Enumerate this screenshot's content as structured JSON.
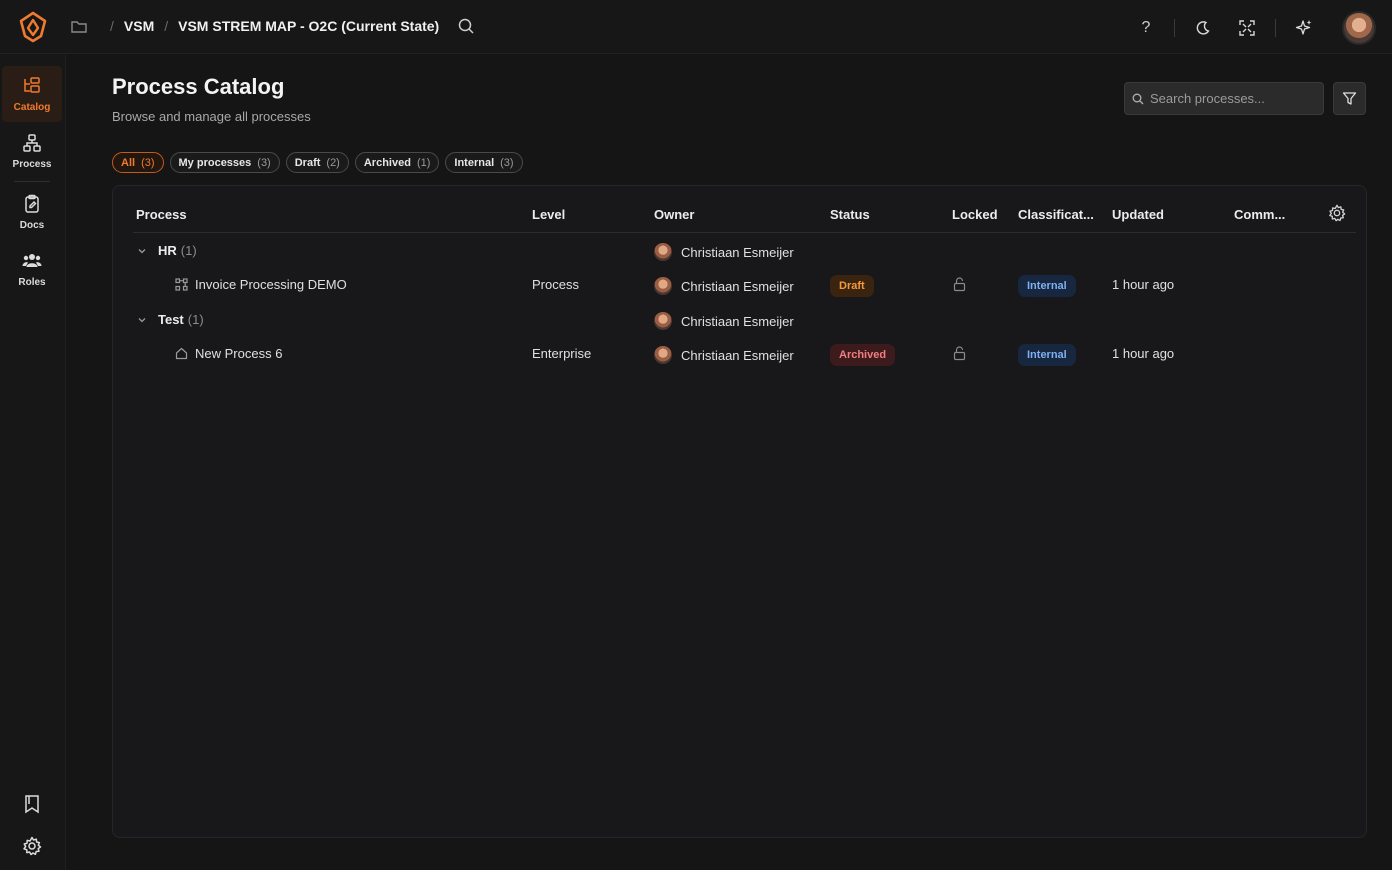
{
  "topbar": {
    "crumbs": [
      "VSM",
      "VSM STREM MAP - O2C (Current State)"
    ],
    "sep": "/",
    "help": "?"
  },
  "rail": {
    "items": [
      {
        "label": "Catalog",
        "icon": "catalog-icon",
        "active": true
      },
      {
        "label": "Process",
        "icon": "sitemap-icon",
        "active": false
      },
      {
        "label": "Docs",
        "icon": "clipboard-icon",
        "active": false
      },
      {
        "label": "Roles",
        "icon": "users-icon",
        "active": false
      }
    ]
  },
  "page": {
    "title": "Process Catalog",
    "subtitle": "Browse and manage all processes",
    "search_placeholder": "Search processes..."
  },
  "filters": [
    {
      "label": "All",
      "count": "(3)",
      "active": true
    },
    {
      "label": "My processes",
      "count": "(3)",
      "active": false
    },
    {
      "label": "Draft",
      "count": "(2)",
      "active": false
    },
    {
      "label": "Archived",
      "count": "(1)",
      "active": false
    },
    {
      "label": "Internal",
      "count": "(3)",
      "active": false
    }
  ],
  "table": {
    "columns": [
      "Process",
      "Level",
      "Owner",
      "Status",
      "Locked",
      "Classificat...",
      "Updated",
      "Comm..."
    ],
    "groups": [
      {
        "name": "HR",
        "count": "(1)",
        "owner": "Christiaan Esmeijer",
        "items": [
          {
            "name": "Invoice Processing DEMO",
            "icon": "process-flow-icon",
            "level": "Process",
            "owner": "Christiaan Esmeijer",
            "status": "Draft",
            "classification": "Internal",
            "updated": "1 hour ago"
          }
        ]
      },
      {
        "name": "Test",
        "count": "(1)",
        "owner": "Christiaan Esmeijer",
        "items": [
          {
            "name": "New Process 6",
            "icon": "home-icon",
            "level": "Enterprise",
            "owner": "Christiaan Esmeijer",
            "status": "Archived",
            "classification": "Internal",
            "updated": "1 hour ago"
          }
        ]
      }
    ]
  },
  "colors": {
    "accent": "#f07a2e",
    "background": "#151516",
    "draft": "#f29a3d",
    "archived": "#f07f7f",
    "internal": "#7fb0f2"
  }
}
